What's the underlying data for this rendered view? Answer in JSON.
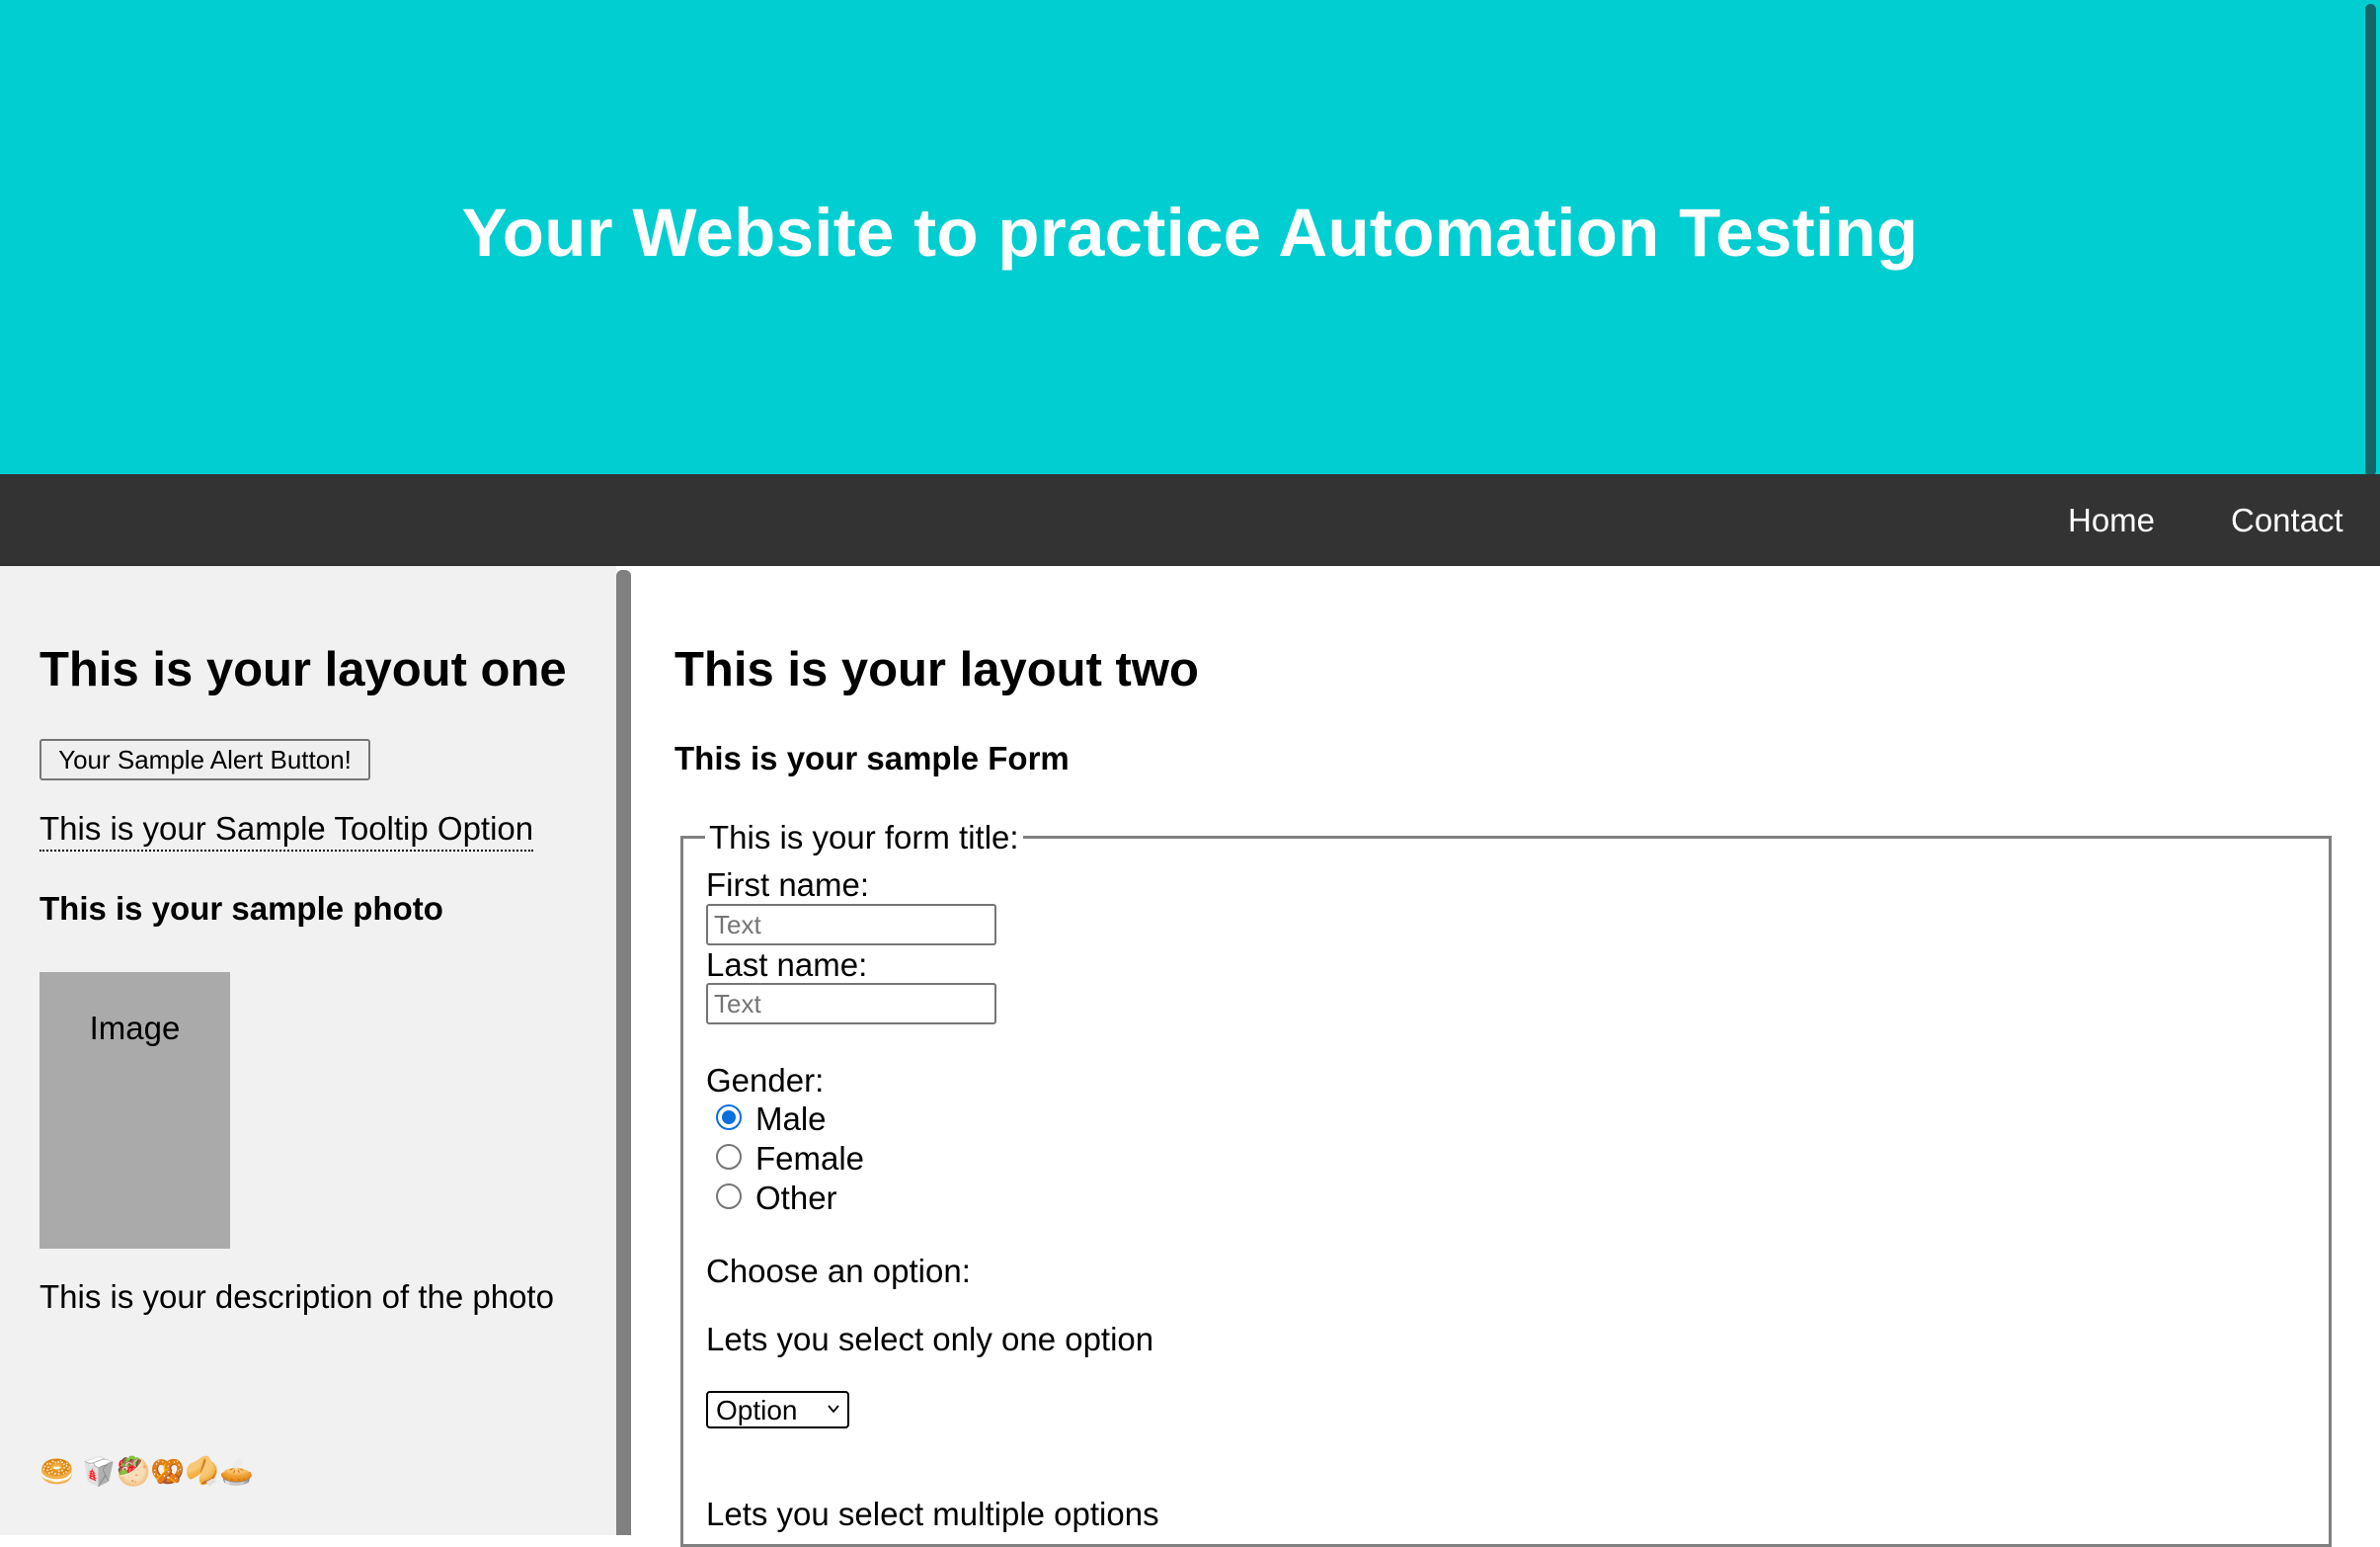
{
  "header": {
    "title": "Your Website to practice Automation Testing"
  },
  "nav": {
    "items": [
      {
        "label": "Home"
      },
      {
        "label": "Contact"
      }
    ]
  },
  "layout_one": {
    "heading": "This is your layout one",
    "alert_button_label": "Your Sample Alert Button!",
    "tooltip_text": "This is your Sample Tooltip Option",
    "photo_heading": "This is your sample photo",
    "photo_placeholder": "Image",
    "photo_description": "This is your description of the photo",
    "emoji_row": "🥯 🥡🥙🥨🥠🥧"
  },
  "layout_two": {
    "heading": "This is your layout two",
    "form_heading": "This is your sample Form",
    "form": {
      "legend": "This is your form title:",
      "first_name_label": "First name:",
      "first_name_placeholder": "Text",
      "last_name_label": "Last name:",
      "last_name_placeholder": "Text",
      "gender_label": "Gender:",
      "gender_options": [
        {
          "label": "Male",
          "checked": true
        },
        {
          "label": "Female",
          "checked": false
        },
        {
          "label": "Other",
          "checked": false
        }
      ],
      "choose_label": "Choose an option:",
      "single_select_label": "Lets you select only one option",
      "single_select_value": "Option",
      "multi_select_label": "Lets you select multiple options"
    }
  },
  "colors": {
    "header_bg": "#00ced1",
    "nav_bg": "#333333",
    "left_bg": "#f1f1f1",
    "radio_accent": "#0b6fe0"
  }
}
